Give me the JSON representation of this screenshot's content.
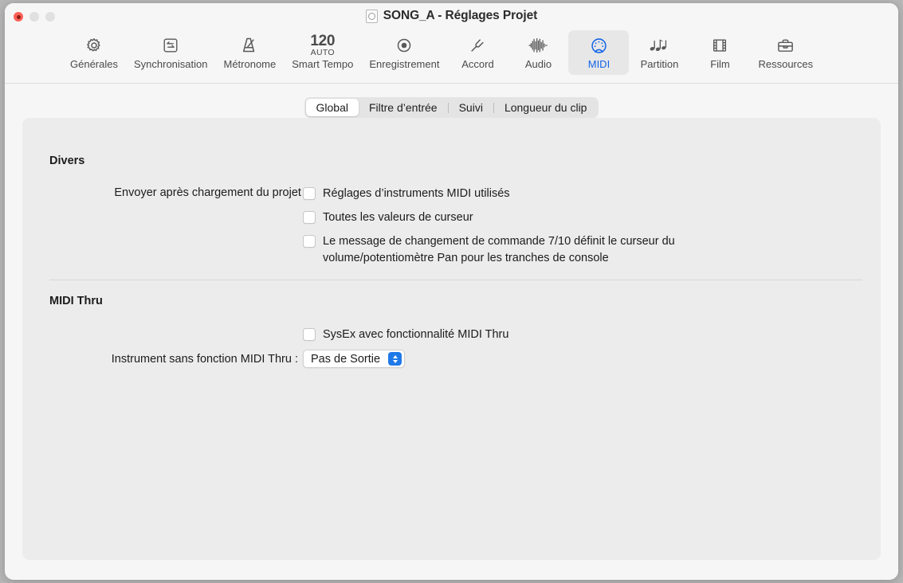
{
  "window": {
    "title": "SONG_A - Réglages Projet",
    "doc_icon": "document-icon",
    "traffic_lights": {
      "close": "close-button",
      "minimize": "minimize-button",
      "zoom": "zoom-button"
    }
  },
  "toolbar": {
    "items": [
      {
        "label": "Générales",
        "icon": "gear-icon",
        "selected": false
      },
      {
        "label": "Synchronisation",
        "icon": "sync-icon",
        "selected": false
      },
      {
        "label": "Métronome",
        "icon": "metronome-icon",
        "selected": false
      },
      {
        "label": "Smart Tempo",
        "icon": "tempo-icon",
        "selected": false,
        "tempo_value": "120",
        "tempo_mode": "AUTO"
      },
      {
        "label": "Enregistrement",
        "icon": "record-icon",
        "selected": false
      },
      {
        "label": "Accord",
        "icon": "tuning-fork-icon",
        "selected": false
      },
      {
        "label": "Audio",
        "icon": "waveform-icon",
        "selected": false
      },
      {
        "label": "MIDI",
        "icon": "midi-din-icon",
        "selected": true
      },
      {
        "label": "Partition",
        "icon": "music-notes-icon",
        "selected": false
      },
      {
        "label": "Film",
        "icon": "film-strip-icon",
        "selected": false
      },
      {
        "label": "Ressources",
        "icon": "briefcase-icon",
        "selected": false
      }
    ]
  },
  "tabs": {
    "items": [
      {
        "label": "Global",
        "active": true
      },
      {
        "label": "Filtre d’entrée",
        "active": false
      },
      {
        "label": "Suivi",
        "active": false
      },
      {
        "label": "Longueur du clip",
        "active": false
      }
    ]
  },
  "divers": {
    "heading": "Divers",
    "send_label": "Envoyer après chargement du projet :",
    "options": [
      {
        "label": "Réglages d’instruments MIDI utilisés",
        "checked": false
      },
      {
        "label": "Toutes les valeurs de curseur",
        "checked": false
      },
      {
        "label": "Le message de changement de commande 7/10 définit le curseur du volume/potentiomètre Pan pour les tranches de console",
        "checked": false
      }
    ]
  },
  "midi_thru": {
    "heading": "MIDI Thru",
    "sysex": {
      "label": "SysEx avec fonctionnalité MIDI Thru",
      "checked": false
    },
    "instrument_label": "Instrument sans fonction MIDI Thru :",
    "instrument_value": "Pas de Sortie"
  },
  "colors": {
    "accent": "#2079e8",
    "selected_tab_text": "#1565e8",
    "window_bg": "#f6f6f6",
    "panel_bg": "#ececec"
  }
}
